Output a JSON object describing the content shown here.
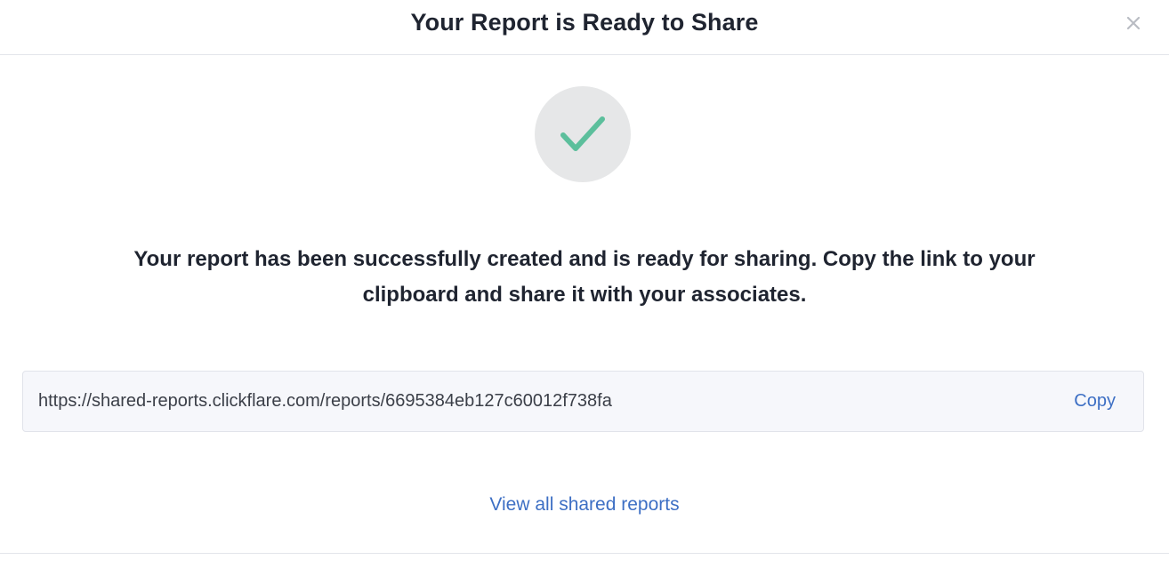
{
  "modal": {
    "title": "Your Report is Ready to Share",
    "close_icon": "close-icon",
    "status_icon": "checkmark-icon",
    "accent_color": "#5cbf9c",
    "message": "Your report has been successfully created and is ready for sharing. Copy the link to your clipboard and share it with your associates.",
    "share_link": {
      "value": "https://shared-reports.clickflare.com/reports/6695384eb127c60012f738fa",
      "copy_label": "Copy"
    },
    "view_all_label": "View all shared reports",
    "link_color": "#3d6fc4"
  }
}
